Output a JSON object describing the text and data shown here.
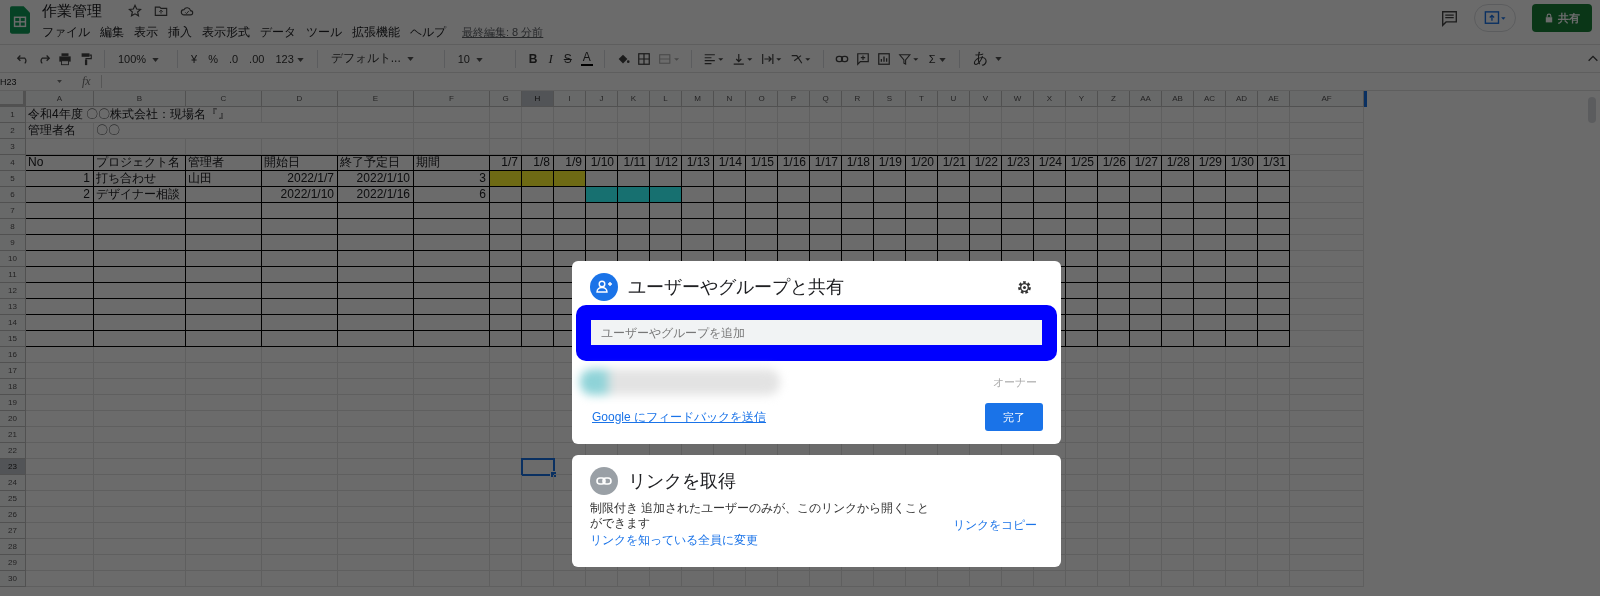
{
  "document": {
    "title": "作業管理",
    "last_edit": "最終編集: 8 分前"
  },
  "menu": [
    "ファイル",
    "編集",
    "表示",
    "挿入",
    "表示形式",
    "データ",
    "ツール",
    "拡張機能",
    "ヘルプ"
  ],
  "share_button": {
    "label": "共有"
  },
  "toolbar": {
    "zoom": "100%",
    "currency": "¥",
    "percent": "%",
    "decrease_decimal": ".0",
    "increase_decimal": ".00",
    "format": "123",
    "font": "デフォルト...",
    "font_size": "10",
    "bold": "B",
    "italic": "I",
    "strikethrough": "S",
    "text_color": "A",
    "functions": "Σ",
    "input_tools": "あ"
  },
  "formula_bar": {
    "name_box": "H23",
    "fx": "fx"
  },
  "columns": [
    {
      "label": "A",
      "selected": false
    },
    {
      "label": "B",
      "selected": false
    },
    {
      "label": "C",
      "selected": false
    },
    {
      "label": "D",
      "selected": false
    },
    {
      "label": "E",
      "selected": false
    },
    {
      "label": "F",
      "selected": false
    },
    {
      "label": "G",
      "selected": false
    },
    {
      "label": "H",
      "selected": true
    },
    {
      "label": "I",
      "selected": false
    },
    {
      "label": "J",
      "selected": false
    },
    {
      "label": "K",
      "selected": false
    },
    {
      "label": "L",
      "selected": false
    },
    {
      "label": "M",
      "selected": false
    },
    {
      "label": "N",
      "selected": false
    },
    {
      "label": "O",
      "selected": false
    },
    {
      "label": "P",
      "selected": false
    },
    {
      "label": "Q",
      "selected": false
    },
    {
      "label": "R",
      "selected": false
    },
    {
      "label": "S",
      "selected": false
    },
    {
      "label": "T",
      "selected": false
    },
    {
      "label": "U",
      "selected": false
    },
    {
      "label": "V",
      "selected": false
    },
    {
      "label": "W",
      "selected": false
    },
    {
      "label": "X",
      "selected": false
    },
    {
      "label": "Y",
      "selected": false
    },
    {
      "label": "Z",
      "selected": false
    },
    {
      "label": "AA",
      "selected": false
    },
    {
      "label": "AB",
      "selected": false
    },
    {
      "label": "AC",
      "selected": false
    },
    {
      "label": "AD",
      "selected": false
    },
    {
      "label": "AE",
      "selected": false
    },
    {
      "label": "AF",
      "selected": false
    }
  ],
  "rows": [
    {
      "number": "1",
      "selected": false,
      "bordered": false,
      "cells": [
        {
          "text": "令和4年度 〇〇株式会社：現場名『』",
          "numeric": false
        }
      ]
    },
    {
      "number": "2",
      "selected": false,
      "bordered": false,
      "cells": [
        {
          "text": "管理者名",
          "numeric": false
        },
        {
          "text": "〇〇",
          "numeric": false
        }
      ]
    },
    {
      "number": "3",
      "selected": false,
      "bordered": false
    },
    {
      "number": "4",
      "selected": false,
      "bordered": true,
      "cells": [
        {
          "text": "No",
          "numeric": false
        },
        {
          "text": "プロジェクト名",
          "numeric": false
        },
        {
          "text": "管理者",
          "numeric": false
        },
        {
          "text": "開始日",
          "numeric": false
        },
        {
          "text": "終了予定日",
          "numeric": false
        },
        {
          "text": "期間",
          "numeric": false
        },
        {
          "text": "1/7",
          "numeric": true
        },
        {
          "text": "1/8",
          "numeric": true
        },
        {
          "text": "1/9",
          "numeric": true
        },
        {
          "text": "1/10",
          "numeric": true
        },
        {
          "text": "1/11",
          "numeric": true
        },
        {
          "text": "1/12",
          "numeric": true
        },
        {
          "text": "1/13",
          "numeric": true
        },
        {
          "text": "1/14",
          "numeric": true
        },
        {
          "text": "1/15",
          "numeric": true
        },
        {
          "text": "1/16",
          "numeric": true
        },
        {
          "text": "1/17",
          "numeric": true
        },
        {
          "text": "1/18",
          "numeric": true
        },
        {
          "text": "1/19",
          "numeric": true
        },
        {
          "text": "1/20",
          "numeric": true
        },
        {
          "text": "1/21",
          "numeric": true
        },
        {
          "text": "1/22",
          "numeric": true
        },
        {
          "text": "1/23",
          "numeric": true
        },
        {
          "text": "1/24",
          "numeric": true
        },
        {
          "text": "1/25",
          "numeric": true
        },
        {
          "text": "1/26",
          "numeric": true
        },
        {
          "text": "1/27",
          "numeric": true
        },
        {
          "text": "1/28",
          "numeric": true
        },
        {
          "text": "1/29",
          "numeric": true
        },
        {
          "text": "1/30",
          "numeric": true
        },
        {
          "text": "1/31",
          "numeric": true
        }
      ]
    },
    {
      "number": "5",
      "selected": false,
      "bordered": true,
      "cells": [
        {
          "text": "1",
          "numeric": true
        },
        {
          "text": "打ち合わせ",
          "numeric": false
        },
        {
          "text": "山田",
          "numeric": false
        },
        {
          "text": "2022/1/7",
          "numeric": true
        },
        {
          "text": "2022/1/10",
          "numeric": true
        },
        {
          "text": "3",
          "numeric": true
        }
      ],
      "gantt": {
        "color": "#6e6a14",
        "days": [
          true,
          true,
          true,
          false,
          false,
          false,
          false,
          false,
          false,
          false,
          false,
          false,
          false,
          false,
          false,
          false,
          false,
          false,
          false,
          false,
          false,
          false,
          false,
          false,
          false
        ]
      }
    },
    {
      "number": "6",
      "selected": false,
      "bordered": true,
      "cells": [
        {
          "text": "2",
          "numeric": true
        },
        {
          "text": "デザイナー相談",
          "numeric": false
        },
        null,
        {
          "text": "2022/1/10",
          "numeric": true
        },
        {
          "text": "2022/1/16",
          "numeric": true
        },
        {
          "text": "6",
          "numeric": true
        }
      ],
      "gantt": {
        "color": "#177070",
        "days": [
          false,
          false,
          false,
          true,
          true,
          true,
          false,
          false,
          false,
          false,
          false,
          false,
          false,
          false,
          false,
          false,
          false,
          false,
          false,
          false,
          false,
          false,
          false,
          false,
          false
        ]
      }
    },
    {
      "number": "7",
      "selected": false,
      "bordered": true
    },
    {
      "number": "8",
      "selected": false,
      "bordered": true
    },
    {
      "number": "9",
      "selected": false,
      "bordered": true
    },
    {
      "number": "10",
      "selected": false,
      "bordered": true
    },
    {
      "number": "11",
      "selected": false,
      "bordered": true
    },
    {
      "number": "12",
      "selected": false,
      "bordered": true
    },
    {
      "number": "13",
      "selected": false,
      "bordered": true
    },
    {
      "number": "14",
      "selected": false,
      "bordered": true
    },
    {
      "number": "15",
      "selected": false,
      "bordered": true
    },
    {
      "number": "16",
      "selected": false,
      "bordered": false
    },
    {
      "number": "17",
      "selected": false,
      "bordered": false
    },
    {
      "number": "18",
      "selected": false,
      "bordered": false
    },
    {
      "number": "19",
      "selected": false,
      "bordered": false
    },
    {
      "number": "20",
      "selected": false,
      "bordered": false
    },
    {
      "number": "21",
      "selected": false,
      "bordered": false
    },
    {
      "number": "22",
      "selected": false,
      "bordered": false
    },
    {
      "number": "23",
      "selected": true,
      "bordered": false
    },
    {
      "number": "24",
      "selected": false,
      "bordered": false
    },
    {
      "number": "25",
      "selected": false,
      "bordered": false
    },
    {
      "number": "26",
      "selected": false,
      "bordered": false
    },
    {
      "number": "27",
      "selected": false,
      "bordered": false
    },
    {
      "number": "28",
      "selected": false,
      "bordered": false
    },
    {
      "number": "29",
      "selected": false,
      "bordered": false
    },
    {
      "number": "30",
      "selected": false,
      "bordered": false
    }
  ],
  "share_dialog": {
    "title": "ユーザーやグループと共有",
    "add_field": {
      "placeholder": "ユーザーやグループを追加"
    },
    "owner_role": "オーナー",
    "feedback_link": "Google にフィードバックを送信",
    "done_button": "完了"
  },
  "link_dialog": {
    "title": "リンクを取得",
    "description": "制限付き 追加されたユーザーのみが、このリンクから開くことができます",
    "change_link": "リンクを知っている全員に変更",
    "copy_link": "リンクをコピー"
  }
}
